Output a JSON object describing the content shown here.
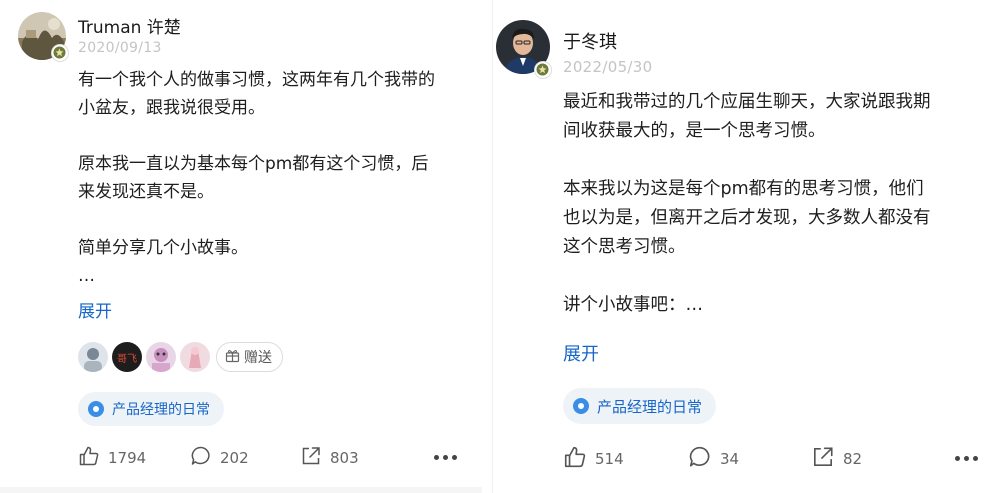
{
  "posts": [
    {
      "user": {
        "name": "Truman 许楚",
        "date": "2020/09/13"
      },
      "paragraphs": [
        [
          "有一个我个人的做事习惯，这两年有几个我带的",
          "小盆友，跟我说很受用。"
        ],
        [
          "原本我一直以为基本每个pm都有这个习惯，后",
          "来发现还真不是。"
        ],
        [
          "简单分享几个小故事。",
          "…"
        ]
      ],
      "expand_label": "展开",
      "liker_labels": [
        "",
        "哥飞",
        "",
        ""
      ],
      "gift_label": "赠送",
      "topic": "产品经理的日常",
      "stats": {
        "likes": "1794",
        "comments": "202",
        "shares": "803"
      }
    },
    {
      "user": {
        "name": "于冬琪",
        "date": "2022/05/30"
      },
      "paragraphs": [
        [
          "最近和我带过的几个应届生聊天，大家说跟我期",
          "间收获最大的，是一个思考习惯。"
        ],
        [
          "本来我以为这是每个pm都有的思考习惯，他们",
          "也以为是，但离开之后才发现，大多数人都没有",
          "这个思考习惯。"
        ],
        [
          "讲个小故事吧：…"
        ]
      ],
      "expand_label": "展开",
      "topic": "产品经理的日常",
      "stats": {
        "likes": "514",
        "comments": "34",
        "shares": "82"
      }
    }
  ],
  "colors": {
    "link": "#1766c8",
    "topic_bg": "#eef3f8",
    "meta": "#c4c4c4"
  },
  "icons": [
    "thumbs-up-icon",
    "comment-icon",
    "share-icon",
    "more-icon",
    "gift-icon",
    "topic-icon",
    "verified-badge-icon"
  ]
}
